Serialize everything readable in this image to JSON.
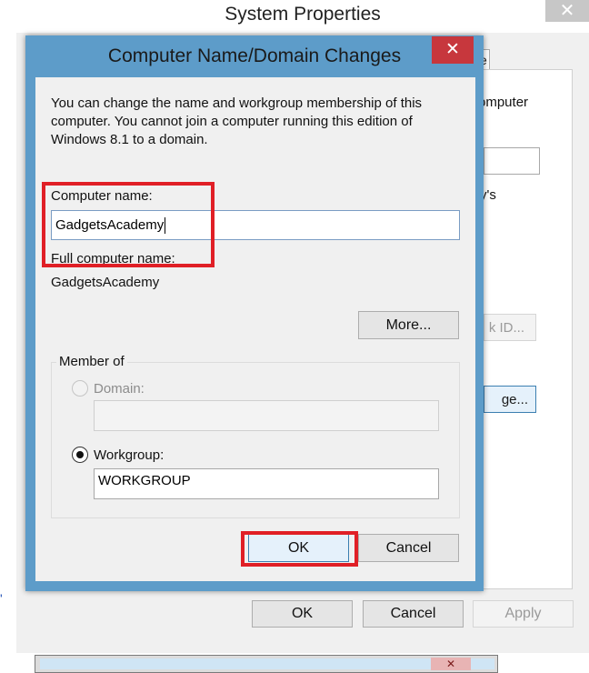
{
  "background_window": {
    "title": "System Properties",
    "close_glyph": "✕",
    "tab_fragment": "e",
    "fragments": {
      "computer_desc": "omputer",
      "org_text": "y's",
      "network_id_button": "k ID...",
      "change_button": "ge..."
    },
    "buttons": {
      "ok": "OK",
      "cancel": "Cancel",
      "apply": "Apply"
    },
    "stray_mark": "'"
  },
  "dialog": {
    "title": "Computer Name/Domain Changes",
    "close_glyph": "✕",
    "description": "You can change the name and workgroup membership of this computer. You cannot join a computer running this edition of Windows 8.1 to a domain.",
    "computer_name_label": "Computer name:",
    "computer_name_value": "GadgetsAcademy",
    "full_name_label": "Full computer name:",
    "full_name_value": "GadgetsAcademy",
    "more_button": "More...",
    "member_of": {
      "label": "Member of",
      "domain_label": "Domain:",
      "domain_value": "",
      "domain_selected": false,
      "domain_enabled": false,
      "workgroup_label": "Workgroup:",
      "workgroup_value": "WORKGROUP",
      "workgroup_selected": true
    },
    "ok_button": "OK",
    "cancel_button": "Cancel"
  },
  "partial_bottom_window": {
    "close_glyph": "✕"
  },
  "colors": {
    "dialog_frame": "#5d9cc9",
    "close_red": "#c7373d",
    "highlight_red": "#e01f26",
    "client_bg": "#f0f0f0"
  }
}
